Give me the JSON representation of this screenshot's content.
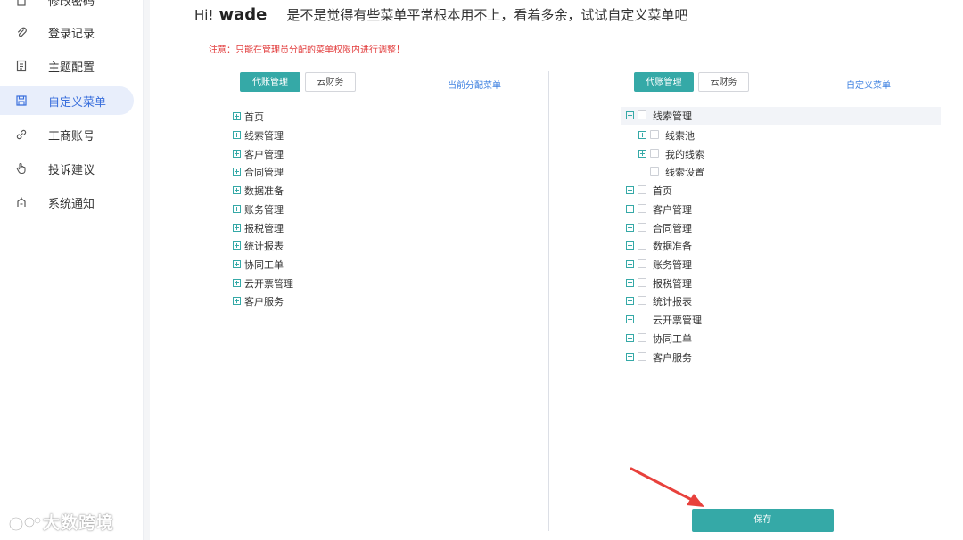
{
  "sidebar": {
    "items": [
      {
        "label": "修改密码",
        "icon": "lock-icon"
      },
      {
        "label": "登录记录",
        "icon": "paperclip-icon"
      },
      {
        "label": "主题配置",
        "icon": "document-icon"
      },
      {
        "label": "自定义菜单",
        "icon": "save-icon",
        "active": true
      },
      {
        "label": "工商账号",
        "icon": "link-icon"
      },
      {
        "label": "投诉建议",
        "icon": "hand-icon"
      },
      {
        "label": "系统通知",
        "icon": "notice-icon"
      }
    ],
    "watermark": "大数跨境"
  },
  "greeting": {
    "hi": "Hi!",
    "user": "wade",
    "message": "是不是觉得有些菜单平常根本用不上，看着多余，试试自定义菜单吧"
  },
  "notice": "注意：只能在管理员分配的菜单权限内进行调整！",
  "left_panel": {
    "tabs": [
      "代账管理",
      "云财务"
    ],
    "active_tab": "代账管理",
    "link": "当前分配菜单",
    "items": [
      "首页",
      "线索管理",
      "客户管理",
      "合同管理",
      "数据准备",
      "账务管理",
      "报税管理",
      "统计报表",
      "协同工单",
      "云开票管理",
      "客户服务"
    ]
  },
  "right_panel": {
    "tabs": [
      "代账管理",
      "云财务"
    ],
    "active_tab": "代账管理",
    "link": "自定义菜单",
    "expanded": {
      "label": "线索管理",
      "children": [
        "线索池",
        "我的线索",
        "线索设置"
      ]
    },
    "items": [
      "首页",
      "客户管理",
      "合同管理",
      "数据准备",
      "账务管理",
      "报税管理",
      "统计报表",
      "云开票管理",
      "协同工单",
      "客户服务"
    ]
  },
  "save_label": "保存",
  "colors": {
    "accent": "#35a9a7",
    "link": "#3b7fe0",
    "warning": "#e23c3c",
    "active_nav": "#e8eefb"
  }
}
